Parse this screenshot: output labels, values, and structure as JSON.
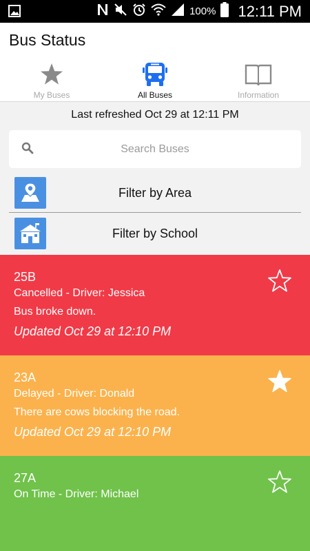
{
  "status_bar": {
    "battery_pct": "100%",
    "time": "12:11 PM",
    "icons": [
      "image-icon",
      "nfc-icon",
      "mute-icon",
      "alarm-icon",
      "wifi-icon",
      "signal-icon",
      "battery-icon"
    ],
    "color": "#000000"
  },
  "header": {
    "title": "Bus Status",
    "tabs": [
      {
        "label": "My Buses",
        "icon": "star-icon",
        "active": false
      },
      {
        "label": "All Buses",
        "icon": "bus-icon",
        "active": true
      },
      {
        "label": "Information",
        "icon": "book-icon",
        "active": false
      }
    ],
    "accent": "#1e6ff0"
  },
  "refresh": {
    "text": "Last refreshed Oct 29 at 12:11 PM"
  },
  "search": {
    "placeholder": "Search Buses",
    "value": "",
    "icon": "search-icon"
  },
  "filters": [
    {
      "label": "Filter by Area",
      "icon": "map-icon"
    },
    {
      "label": "Filter by School",
      "icon": "school-icon"
    }
  ],
  "buses": [
    {
      "route": "25B",
      "status": "Cancelled - Driver: Jessica",
      "message": "Bus broke down.",
      "updated": "Updated Oct 29 at 12:10 PM",
      "favorite": false,
      "color": "#f13a47"
    },
    {
      "route": "23A",
      "status": "Delayed - Driver: Donald",
      "message": "There are cows blocking the road.",
      "updated": "Updated Oct 29 at 12:10 PM",
      "favorite": true,
      "color": "#fbb24c"
    },
    {
      "route": "27A",
      "status": "On Time - Driver: Michael",
      "message": "",
      "updated": "",
      "favorite": false,
      "color": "#70c24a"
    }
  ]
}
